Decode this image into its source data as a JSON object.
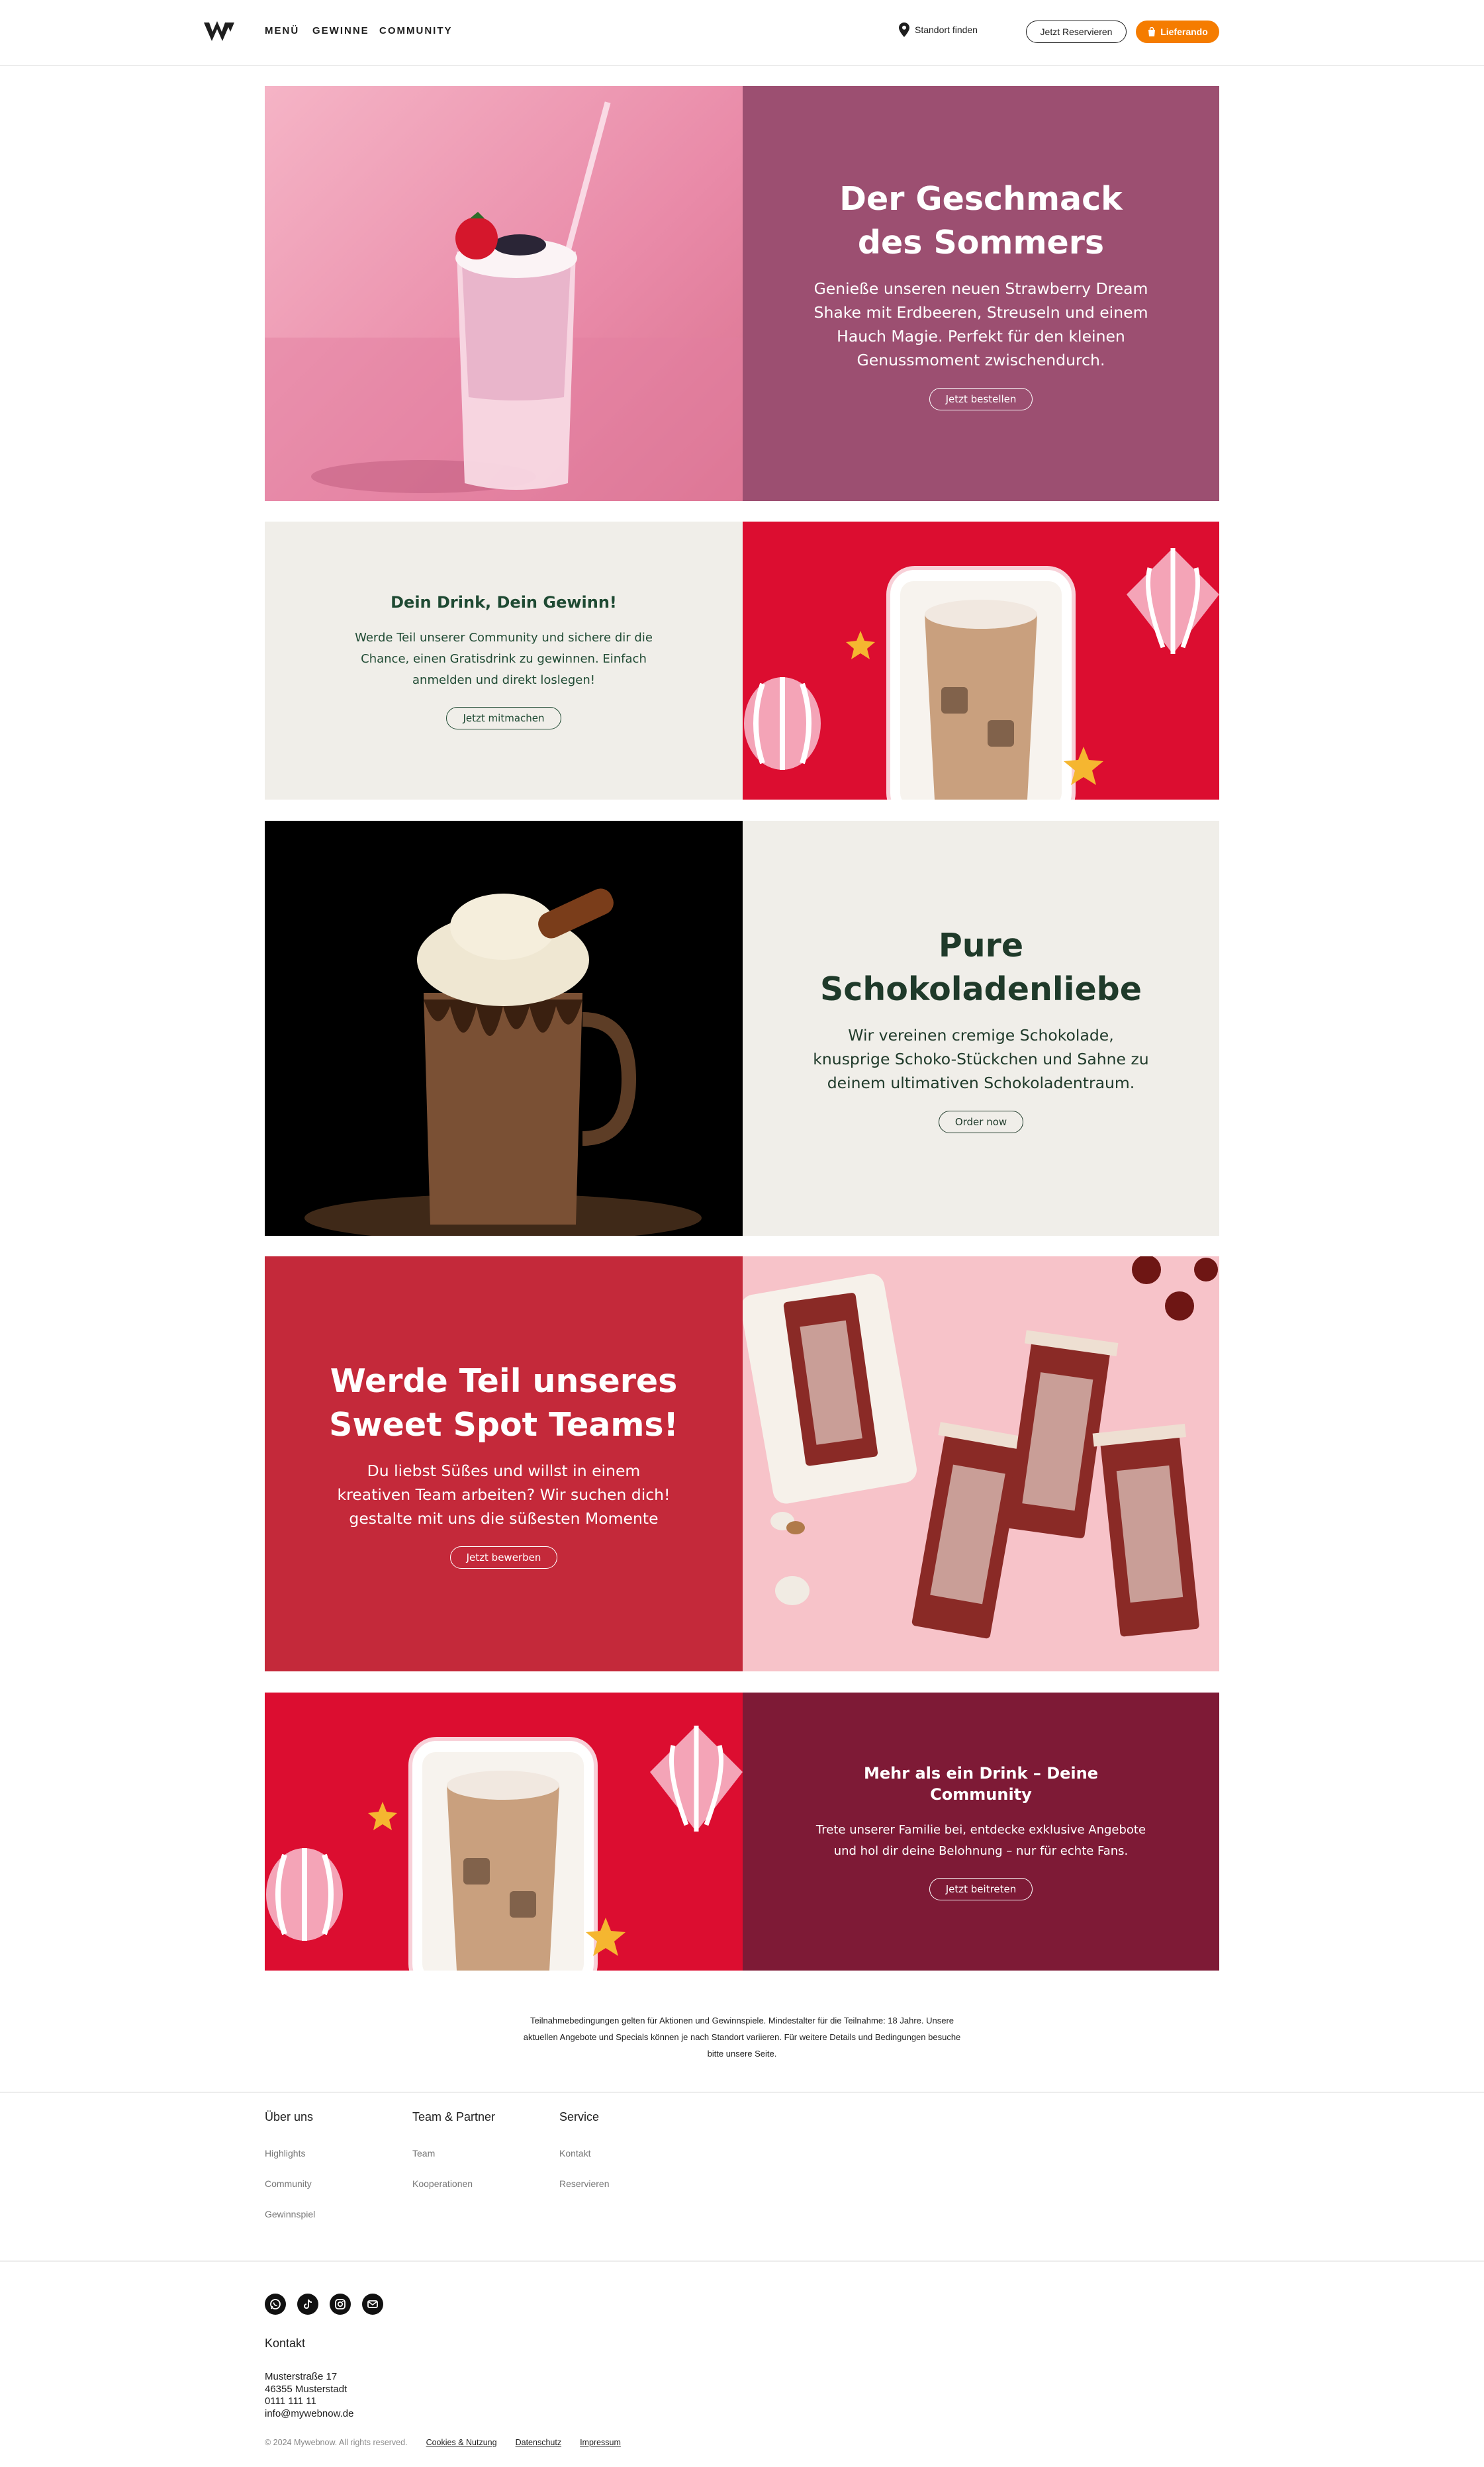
{
  "header": {
    "nav": [
      "MENÜ",
      "GEWINNE",
      "COMMUNITY"
    ],
    "location": "Standort finden",
    "reserve_button": "Jetzt Reservieren",
    "delivery_button": "Lieferando"
  },
  "hero": {
    "title_line1": "Der Geschmack",
    "title_line2": "des Sommers",
    "text": "Genieße unseren neuen Strawberry Dream Shake mit Erdbeeren, Streuseln und einem Hauch Magie. Perfekt für den kleinen Genussmoment zwischendurch.",
    "button": "Jetzt bestellen"
  },
  "win": {
    "title": "Dein Drink, Dein Gewinn!",
    "text": "Werde Teil unserer Community und sichere dir die Chance, einen Gratisdrink zu gewinnen. Einfach anmelden und direkt loslegen!",
    "button": "Jetzt mitmachen"
  },
  "chocolate": {
    "title_line1": "Pure",
    "title_line2": "Schokoladenliebe",
    "text": "Wir vereinen cremige Schokolade, knusprige Schoko-Stückchen und Sahne zu deinem ultimativen Schokoladentraum.",
    "button": "Order now"
  },
  "team": {
    "title_line1": "Werde Teil unseres",
    "title_line2": "Sweet Spot Teams!",
    "text": "Du liebst Süßes und willst in einem kreativen Team arbeiten? Wir suchen dich! gestalte mit uns die süßesten Momente",
    "button": "Jetzt bewerben"
  },
  "community": {
    "title": "Mehr als ein Drink – Deine Community",
    "text": "Trete unserer Familie bei, entdecke exklusive Angebote und hol dir deine Belohnung – nur für echte Fans.",
    "button": "Jetzt beitreten"
  },
  "disclaimer": "Teilnahmebedingungen gelten für Aktionen und Gewinnspiele. Mindestalter für die Teilnahme: 18 Jahre. Unsere aktuellen Angebote und Specials können je nach Standort variieren. Für weitere Details und Bedingungen besuche bitte unsere Seite.",
  "footer": {
    "columns": [
      {
        "title": "Über uns",
        "links": [
          "Highlights",
          "Community",
          "Gewinnspiel"
        ]
      },
      {
        "title": "Team & Partner",
        "links": [
          "Team",
          "Kooperationen"
        ]
      },
      {
        "title": "Service",
        "links": [
          "Kontakt",
          "Reservieren"
        ]
      }
    ],
    "social_icons": [
      "whatsapp-icon",
      "tiktok-icon",
      "instagram-icon",
      "mail-icon"
    ],
    "contact_title": "Kontakt",
    "address": [
      "Musterstraße 17",
      "46355 Musterstadt",
      "0111 111 11",
      "info@mywebnow.de"
    ],
    "copyright": "© 2024 Mywebnow. All rights reserved.",
    "legal_links": [
      "Cookies & Nutzung",
      "Datenschutz",
      "Impressum"
    ]
  },
  "colors": {
    "hero_bg": "#9c4f71",
    "cream": "#f0eee9",
    "red": "#dc0d30",
    "team_bg": "#c4293a",
    "community_bg": "#7e1a36",
    "dark_green": "#1f3a2a",
    "orange": "#f57c00"
  }
}
